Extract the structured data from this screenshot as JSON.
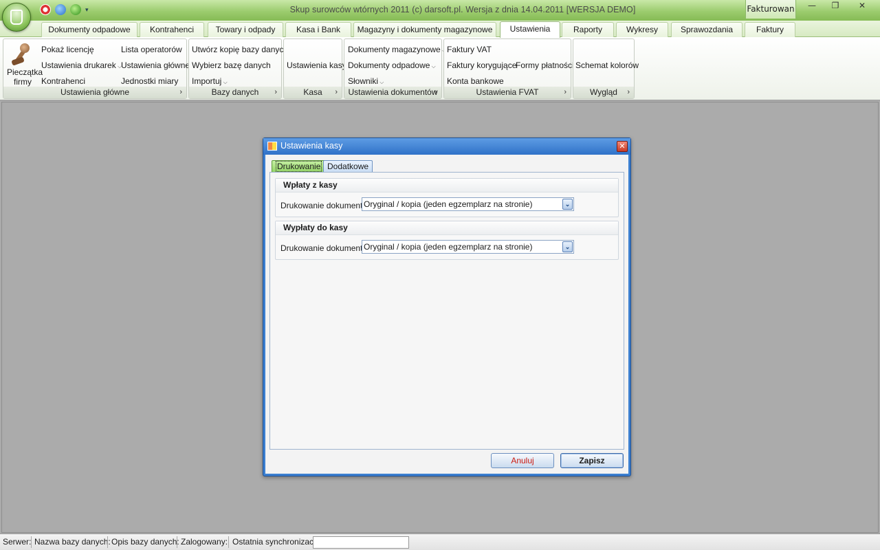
{
  "window": {
    "title": "Skup surowców wtórnych 2011 (c) darsoft.pl. Wersja z dnia 14.04.2011 [WERSJA DEMO]",
    "side_tab": "Fakturowan",
    "buttons": {
      "minimize": "—",
      "restore": "❐",
      "close": "✕"
    }
  },
  "tabs": [
    {
      "label": "Dokumenty odpadowe"
    },
    {
      "label": "Kontrahenci"
    },
    {
      "label": "Towary i odpady"
    },
    {
      "label": "Kasa i Bank"
    },
    {
      "label": "Magazyny i dokumenty magazynowe"
    },
    {
      "label": "Ustawienia"
    },
    {
      "label": "Raporty"
    },
    {
      "label": "Wykresy"
    },
    {
      "label": "Sprawozdania"
    },
    {
      "label": "Faktury"
    }
  ],
  "ribbon": {
    "glowne": {
      "stamp": "Pieczątka firmy",
      "items": [
        "Pokaż licencję",
        "Ustawienia drukarek",
        "Kontrahenci",
        "Lista operatorów",
        "Ustawienia główne",
        "Jednostki miary"
      ],
      "caption": "Ustawienia główne"
    },
    "bazy": {
      "items": [
        "Utwórz kopię bazy danych",
        "Wybierz bazę danych",
        "Importuj"
      ],
      "caption": "Bazy danych"
    },
    "kasa": {
      "items": [
        "Ustawienia kasy"
      ],
      "caption": "Kasa"
    },
    "dokumenty": {
      "items": [
        "Dokumenty magazynowe",
        "Dokumenty odpadowe",
        "Słowniki"
      ],
      "caption": "Ustawienia dokumentów"
    },
    "fvat": {
      "items": [
        "Faktury VAT",
        "Faktury korygujące",
        "Konta bankowe",
        "Formy płatności"
      ],
      "caption": "Ustawienia FVAT"
    },
    "wyglad": {
      "items": [
        "Schemat kolorów"
      ],
      "caption": "Wygląd"
    }
  },
  "dialog": {
    "title": "Ustawienia kasy",
    "tabs": [
      "Drukowanie",
      "Dodatkowe"
    ],
    "section1": {
      "header": "Wpłaty z kasy",
      "label": "Drukowanie dokumentu",
      "value": "Oryginal / kopia (jeden egzemplarz na stronie)"
    },
    "section2": {
      "header": "Wypłaty do kasy",
      "label": "Drukowanie dokumentu",
      "value": "Oryginal / kopia (jeden egzemplarz na stronie)"
    },
    "cancel": "Anuluj",
    "save": "Zapisz"
  },
  "status": [
    "Serwer:",
    "Nazwa bazy danych:",
    "Opis bazy danych:",
    "Zalogowany:",
    "Ostatnia synchronizacja"
  ],
  "colors": {
    "accent_green": "#9ccc6e",
    "dialog_blue": "#3b7fd0",
    "cancel_red": "#cc1a10"
  }
}
